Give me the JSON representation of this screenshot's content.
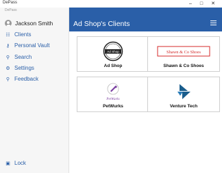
{
  "window": {
    "title": "DePass"
  },
  "sidebar": {
    "brand": "DePass",
    "user": {
      "name": "Jackson Smith"
    },
    "items": [
      {
        "label": "Clients",
        "icon": "people-icon"
      },
      {
        "label": "Personal Vault",
        "icon": "key-icon"
      },
      {
        "label": "Search",
        "icon": "search-icon"
      },
      {
        "label": "Settings",
        "icon": "gear-icon"
      },
      {
        "label": "Feedback",
        "icon": "lightbulb-icon"
      }
    ],
    "lock_label": "Lock"
  },
  "header": {
    "title": "Ad Shop's Clients"
  },
  "clients": [
    {
      "name": "Ad Shop",
      "logo_text": "Ad Shop"
    },
    {
      "name": "Shawn & Co Shoes",
      "logo_text": "Shawn & Co Shoes"
    },
    {
      "name": "PetWurks",
      "logo_text": "PetWurks"
    },
    {
      "name": "Venture Tech"
    }
  ],
  "colors": {
    "accent": "#2a5fa8",
    "sidebar_bg": "#f6f6f6",
    "shawn_red": "#d42a2a",
    "petwurks_purple": "#7a3fa0"
  }
}
